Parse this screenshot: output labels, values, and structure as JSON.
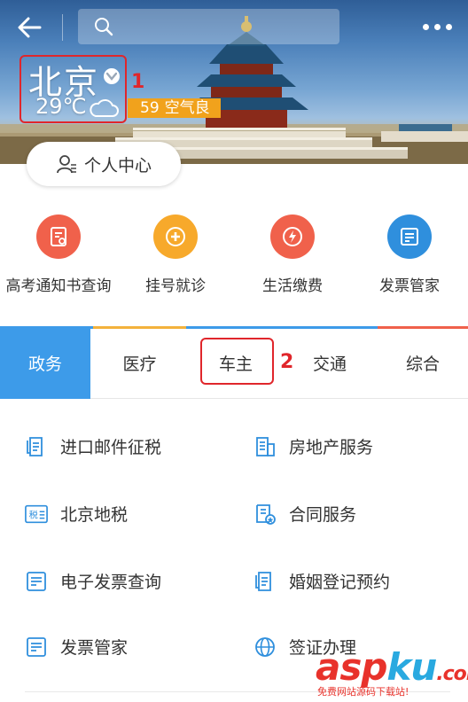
{
  "header": {
    "search_placeholder": "",
    "city": "北京",
    "temperature": "29℃",
    "aqi_value": "59",
    "aqi_text": "空气良",
    "personal_center": "个人中心",
    "annotation_1": "1"
  },
  "quick_services": [
    {
      "label": "高考通知书查询",
      "color": "#f0614b",
      "icon": "document-icon"
    },
    {
      "label": "挂号就诊",
      "color": "#f7a92b",
      "icon": "medical-cross-icon"
    },
    {
      "label": "生活缴费",
      "color": "#f0614b",
      "icon": "flame-icon"
    },
    {
      "label": "发票管家",
      "color": "#2f8fdd",
      "icon": "invoice-icon"
    }
  ],
  "tabs": [
    {
      "label": "政务",
      "active": true
    },
    {
      "label": "医疗",
      "active": false
    },
    {
      "label": "车主",
      "active": false
    },
    {
      "label": "交通",
      "active": false
    },
    {
      "label": "综合",
      "active": false
    }
  ],
  "tab_accent_colors": [
    "#3d9be9",
    "#f3b23c",
    "#3d9be9",
    "#3d9be9",
    "#f0614b"
  ],
  "annotation_2": "2",
  "services": [
    {
      "label": "进口邮件征税",
      "icon": "mail-tax-icon"
    },
    {
      "label": "房地产服务",
      "icon": "building-icon"
    },
    {
      "label": "北京地税",
      "icon": "tax-icon"
    },
    {
      "label": "合同服务",
      "icon": "contract-icon"
    },
    {
      "label": "电子发票查询",
      "icon": "invoice-icon"
    },
    {
      "label": "婚姻登记预约",
      "icon": "document-icon"
    },
    {
      "label": "发票管家",
      "icon": "invoice-icon"
    },
    {
      "label": "签证办理",
      "icon": "globe-icon"
    }
  ],
  "tax_icon_text": "税",
  "watermark": {
    "logo_a": "asp",
    "logo_b": "ku",
    "logo_c": ".com",
    "sub": "免费网站源码下载站!"
  },
  "colors": {
    "accent_blue": "#3d9be9",
    "icon_blue": "#2f8fdd",
    "annotation_red": "#e0262b",
    "aqi_orange": "#f1a21c"
  }
}
